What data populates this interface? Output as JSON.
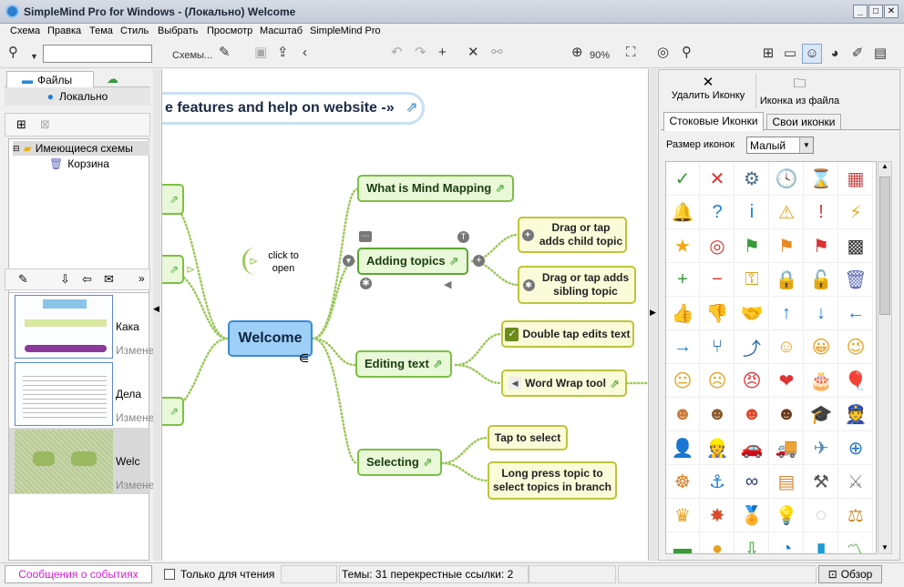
{
  "window": {
    "title": "SimpleMind Pro for Windows - (Локально) Welcome"
  },
  "menu": [
    "Схема",
    "Правка",
    "Тема",
    "Стиль",
    "Выбрать",
    "Просмотр",
    "Масштаб",
    "SimpleMind Pro"
  ],
  "toolbar": {
    "schemes_label": "Схемы...",
    "zoom_label": "90%"
  },
  "left": {
    "tab_files": "Файлы",
    "local_label": "Локально",
    "tree": [
      {
        "label": "Имеющиеся схемы"
      },
      {
        "label": "Корзина"
      }
    ],
    "thumbs": [
      {
        "title": "Кака",
        "sub": "Измене"
      },
      {
        "title": "Дела",
        "sub": "Измене"
      },
      {
        "title": "Welc",
        "sub": "Измене"
      }
    ]
  },
  "mindmap": {
    "banner": "e features and help on website -»",
    "central": "Welcome",
    "click_hint": "click to open",
    "topics": {
      "what": "What is Mind Mapping",
      "adding": "Adding topics",
      "editing": "Editing text",
      "selecting": "Selecting"
    },
    "leaves": {
      "child": "Drag or tap adds child topic",
      "sibling": "Drag or tap adds sibling topic",
      "double": "Double tap edits text",
      "wrap": "Word Wrap tool",
      "tap_select": "Tap to select",
      "long_press": "Long press topic to select topics in branch"
    }
  },
  "right": {
    "delete_icon": "Удалить Иконку",
    "icon_from_file": "Иконка из файла",
    "tab_stock": "Стоковые Иконки",
    "tab_own": "Свои иконки",
    "size_label": "Размер иконок",
    "size_value": "Малый",
    "icons": [
      [
        "check-icon",
        "✓",
        "#3a9a3a"
      ],
      [
        "cross-icon",
        "✕",
        "#d33"
      ],
      [
        "gear-icon",
        "⚙",
        "#4a6a8a"
      ],
      [
        "clock-icon",
        "🕓",
        "#2a7ab8"
      ],
      [
        "hourglass-icon",
        "⌛",
        "#a8782a"
      ],
      [
        "calendar-icon",
        "▦",
        "#c84848"
      ],
      [
        "bell-icon",
        "🔔",
        "#e8a020"
      ],
      [
        "question-icon",
        "?",
        "#1d7fd6"
      ],
      [
        "info-icon",
        "i",
        "#1d7fd6"
      ],
      [
        "warning-icon",
        "⚠",
        "#e8a020"
      ],
      [
        "alert-icon",
        "!",
        "#d33"
      ],
      [
        "lightning-icon",
        "⚡",
        "#e8b020"
      ],
      [
        "star-icon",
        "★",
        "#f0a818"
      ],
      [
        "target-icon",
        "◎",
        "#d33"
      ],
      [
        "green-flag-icon",
        "⚑",
        "#3a9a3a"
      ],
      [
        "orange-flag-icon",
        "⚑",
        "#e88a20"
      ],
      [
        "red-flag-icon",
        "⚑",
        "#d33"
      ],
      [
        "checkered-flag-icon",
        "▩",
        "#333"
      ],
      [
        "plus-icon",
        "+",
        "#3a9a3a"
      ],
      [
        "minus-icon",
        "−",
        "#d33"
      ],
      [
        "key-icon",
        "⚿",
        "#d8a020"
      ],
      [
        "lock-icon",
        "🔒",
        "#e8a020"
      ],
      [
        "unlock-icon",
        "🔓",
        "#e8a020"
      ],
      [
        "trash-icon",
        "🗑",
        "#5a6ab8"
      ],
      [
        "thumbs-up-icon",
        "👍",
        "#e8a020"
      ],
      [
        "thumbs-down-icon",
        "👎",
        "#e8a020"
      ],
      [
        "handshake-icon",
        "🤝",
        "#d89030"
      ],
      [
        "arrow-up-icon",
        "↑",
        "#1d7fd6"
      ],
      [
        "arrow-down-icon",
        "↓",
        "#1d7fd6"
      ],
      [
        "arrow-left-icon",
        "←",
        "#1d7fd6"
      ],
      [
        "arrow-right-icon",
        "→",
        "#1d7fd6"
      ],
      [
        "fork-icon",
        "⑂",
        "#2a6aa8"
      ],
      [
        "merge-icon",
        "⤴",
        "#2a6aa8"
      ],
      [
        "smile-icon",
        "☺",
        "#e8a020"
      ],
      [
        "grin-icon",
        "😀",
        "#e8a020"
      ],
      [
        "wink-icon",
        "😉",
        "#e8a020"
      ],
      [
        "neutral-icon",
        "😐",
        "#e8a020"
      ],
      [
        "sad-icon",
        "☹",
        "#e8a020"
      ],
      [
        "angry-icon",
        "😠",
        "#d33"
      ],
      [
        "heart-icon",
        "❤",
        "#d33"
      ],
      [
        "cake-icon",
        "🎂",
        "#d86aa8"
      ],
      [
        "balloon-icon",
        "🎈",
        "#d33"
      ],
      [
        "person-1-icon",
        "☻",
        "#c87a3a"
      ],
      [
        "person-2-icon",
        "☻",
        "#8a5a2a"
      ],
      [
        "person-3-icon",
        "☻",
        "#d84a2a"
      ],
      [
        "person-4-icon",
        "☻",
        "#6a3a1a"
      ],
      [
        "graduate-icon",
        "🎓",
        "#333"
      ],
      [
        "police-icon",
        "👮",
        "#2a3a6a"
      ],
      [
        "businessman-icon",
        "👤",
        "#555"
      ],
      [
        "worker-icon",
        "👷",
        "#d84a2a"
      ],
      [
        "car-icon",
        "🚗",
        "#d33"
      ],
      [
        "truck-icon",
        "🚚",
        "#3a8a4a"
      ],
      [
        "plane-icon",
        "✈",
        "#5a8ab8"
      ],
      [
        "compass-icon",
        "⊕",
        "#2a7ab8"
      ],
      [
        "helm-icon",
        "☸",
        "#d87a20"
      ],
      [
        "anchor-icon",
        "⚓",
        "#1d7fd6"
      ],
      [
        "binoculars-icon",
        "∞",
        "#2a3a6a"
      ],
      [
        "brick-icon",
        "▤",
        "#d8883a"
      ],
      [
        "hammer-icon",
        "⚒",
        "#555"
      ],
      [
        "sword-icon",
        "⚔",
        "#888"
      ],
      [
        "crown-icon",
        "♛",
        "#e8a020"
      ],
      [
        "explosion-icon",
        "✸",
        "#d84a2a"
      ],
      [
        "medal-icon",
        "🏅",
        "#e8a020"
      ],
      [
        "bulb-icon",
        "💡",
        "#f0c820"
      ],
      [
        "bulb-off-icon",
        "◌",
        "#aaa"
      ],
      [
        "scales-icon",
        "⚖",
        "#c89030"
      ],
      [
        "money-icon",
        "▬",
        "#3a9a3a"
      ],
      [
        "coins-icon",
        "●",
        "#e8a020"
      ],
      [
        "download-icon",
        "⇩",
        "#3a9a3a"
      ],
      [
        "pie-chart-icon",
        "◔",
        "#1d7fd6"
      ],
      [
        "bar-chart-icon",
        "▮",
        "#1d9ad6"
      ],
      [
        "line-chart-icon",
        "〽",
        "#3a9a3a"
      ]
    ]
  },
  "status": {
    "events": "Сообщения о событиях",
    "readonly": "Только для чтения",
    "info": "Темы: 31 перекрестные ссылки: 2",
    "overview": "Обзор"
  }
}
